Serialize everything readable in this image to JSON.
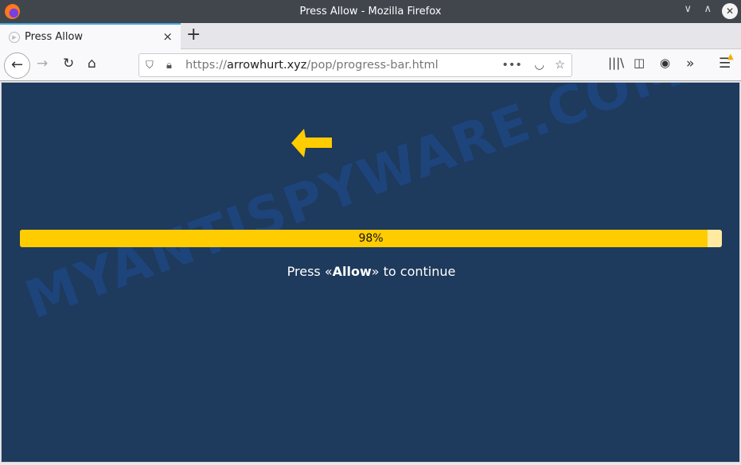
{
  "window": {
    "title": "Press Allow - Mozilla Firefox"
  },
  "tab": {
    "label": "Press Allow",
    "close": "×",
    "new_tab": "+"
  },
  "nav": {
    "url_prefix": "https://",
    "url_domain": "arrowhurt.xyz",
    "url_path": "/pop/progress-bar.html"
  },
  "page": {
    "progress_value": 98,
    "progress_label": "98%",
    "message_pre": "Press «",
    "message_bold": "Allow",
    "message_post": "» to continue",
    "watermark": "MYANTISPYWARE.COM"
  },
  "colors": {
    "background": "#1e3a5c",
    "accent": "#ffcc00"
  }
}
